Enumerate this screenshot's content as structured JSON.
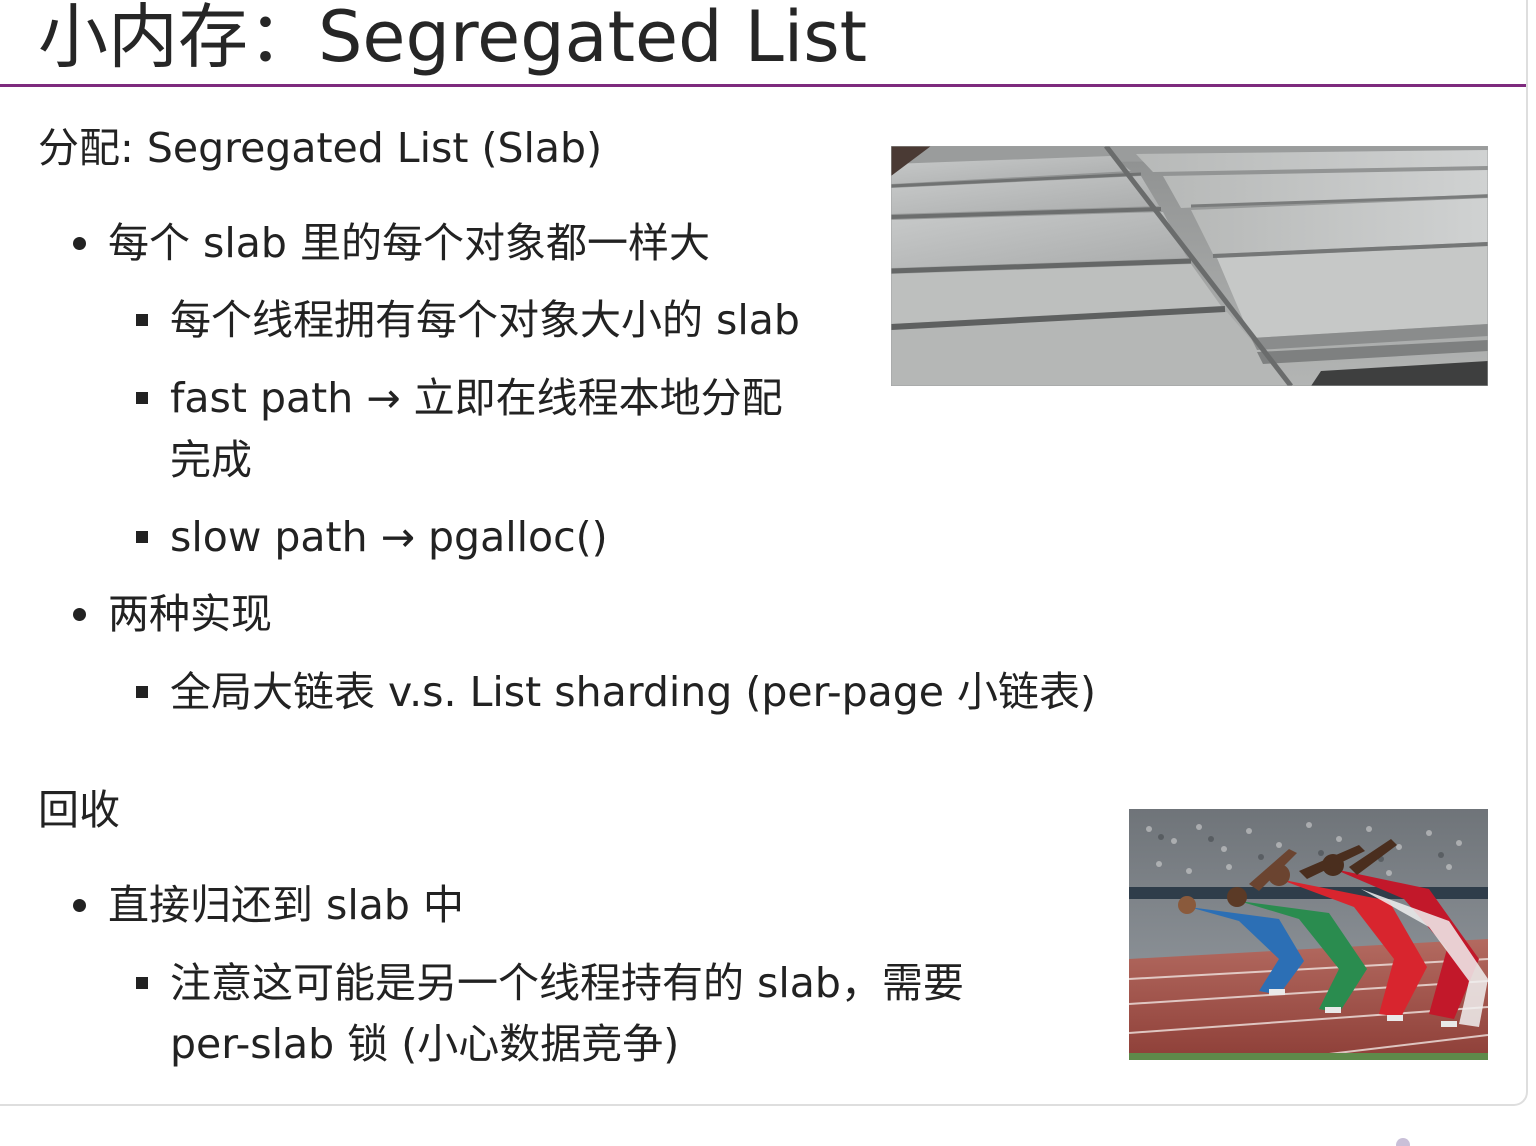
{
  "slide": {
    "title": "小内存：Segregated List",
    "alloc_heading": "分配: Segregated List (Slab)",
    "alloc_points": [
      "每个 slab 里的每个对象都一样大",
      "每个线程拥有每个对象大小的 slab",
      "fast path → 立即在线程本地分配",
      "完成",
      "slow path → pgalloc()",
      "两种实现",
      "全局大链表 v.s. List sharding (per-page 小链表)"
    ],
    "free_heading": "回收",
    "free_points": [
      "直接归还到 slab 中",
      "注意这可能是另一个线程持有的 slab，需要",
      "per-slab 锁 (小心数据竞争)"
    ]
  },
  "colors": {
    "title_rule": "#7e2a7e",
    "text": "#222222",
    "concrete": "#b9bbbb",
    "track": "#a0514a"
  }
}
